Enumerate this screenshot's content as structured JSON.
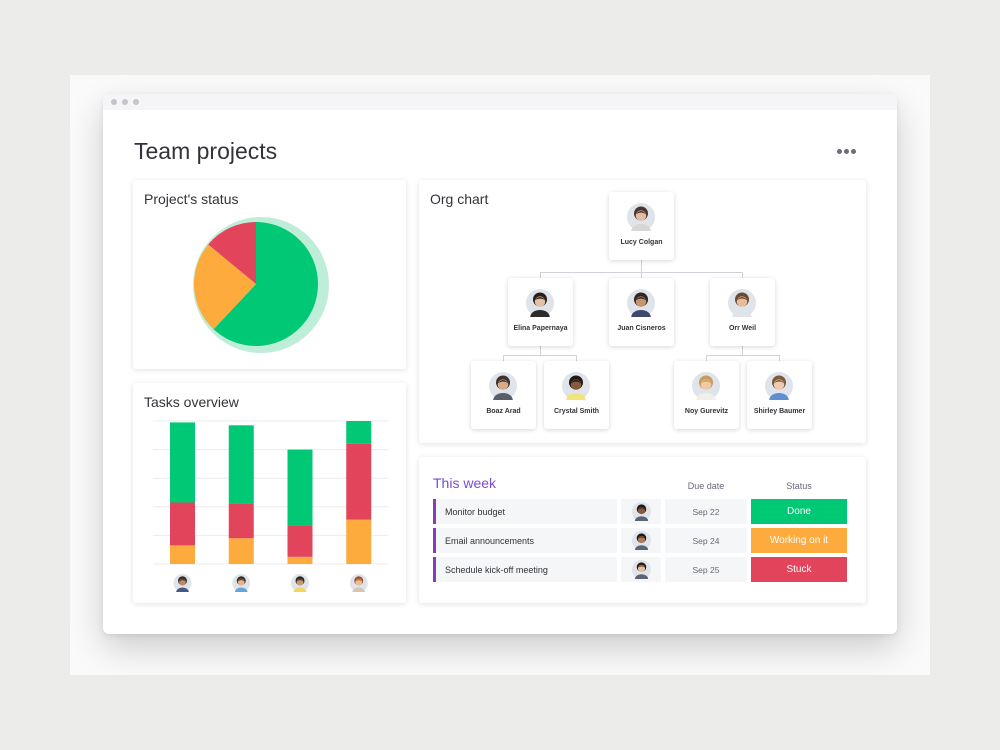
{
  "page_title": "Team projects",
  "colors": {
    "green": "#00c875",
    "green_light": "#bfeed8",
    "red": "#e2445c",
    "orange": "#fdab3d",
    "purple": "#784bd1",
    "week_bar": "#8a3bb8"
  },
  "project_status": {
    "title": "Project's status",
    "slices": [
      {
        "status": "done",
        "fraction": 0.62,
        "color": "#00c875"
      },
      {
        "status": "working",
        "fraction": 0.24,
        "color": "#fdab3d"
      },
      {
        "status": "stuck",
        "fraction": 0.14,
        "color": "#e2445c"
      }
    ]
  },
  "chart_data": [
    {
      "type": "pie",
      "title": "Project's status",
      "values": [
        62,
        24,
        14
      ],
      "colors": [
        "#00c875",
        "#fdab3d",
        "#e2445c"
      ]
    },
    {
      "type": "bar",
      "title": "Tasks overview",
      "stacked": true,
      "categories": [
        "person 1",
        "person 2",
        "person 3",
        "person 4"
      ],
      "ylim": [
        0,
        100
      ],
      "grid": true,
      "series": [
        {
          "status": "working",
          "color": "#fdab3d",
          "values": [
            13,
            18,
            5,
            31
          ]
        },
        {
          "status": "stuck",
          "color": "#e2445c",
          "values": [
            30,
            24,
            22,
            53
          ]
        },
        {
          "status": "done",
          "color": "#00c875",
          "values": [
            56,
            55,
            53,
            16
          ]
        }
      ]
    }
  ],
  "tasks_overview": {
    "title": "Tasks overview",
    "avatars": [
      {
        "icon": "avatar-icon",
        "skin": "#b98a6a",
        "hair": "#3a2a22",
        "shirt": "#445a80"
      },
      {
        "icon": "avatar-icon",
        "skin": "#e2b48f",
        "hair": "#3b2b1f",
        "shirt": "#6aa3d8"
      },
      {
        "icon": "avatar-icon",
        "skin": "#c79a73",
        "hair": "#2e2622",
        "shirt": "#f3d65a"
      },
      {
        "icon": "avatar-icon",
        "skin": "#e9bd98",
        "hair": "#a0502d",
        "shirt": "#d9c3b0"
      }
    ]
  },
  "org_chart": {
    "title": "Org chart",
    "root": {
      "name": "Lucy Colgan",
      "skin": "#e3bca0",
      "hair": "#4a3630",
      "shirt": "#d6d6d6"
    },
    "managers": [
      {
        "name": "Elina Papernaya",
        "skin": "#e6c0a3",
        "hair": "#2a1d18",
        "shirt": "#2b2b2b"
      },
      {
        "name": "Juan Cisneros",
        "skin": "#c9936d",
        "hair": "#2d2622",
        "shirt": "#3e4a6b"
      },
      {
        "name": "Orr Weil",
        "skin": "#e5bd9c",
        "hair": "#6b4a33",
        "shirt": "#dfe4ea"
      }
    ],
    "reports": [
      {
        "name": "Boaz Arad",
        "skin": "#d9a988",
        "hair": "#3a3330",
        "shirt": "#595f69"
      },
      {
        "name": "Crystal Smith",
        "skin": "#8a5a3c",
        "hair": "#1e1a18",
        "shirt": "#f2e37a"
      },
      {
        "name": "Noy Gurevitz",
        "skin": "#efcaa5",
        "hair": "#c89b5e",
        "shirt": "#f0efe9"
      },
      {
        "name": "Shirley Baumer",
        "skin": "#f0cab0",
        "hair": "#7a5a3a",
        "shirt": "#5f8fd0"
      }
    ]
  },
  "this_week": {
    "title": "This week",
    "columns": {
      "due": "Due date",
      "status": "Status"
    },
    "rows": [
      {
        "name": "Monitor budget",
        "date": "Sep 22",
        "status": "Done",
        "status_color": "#00c875",
        "skin": "#8a5a3c",
        "hair": "#1e1a18"
      },
      {
        "name": "Email announcements",
        "date": "Sep 24",
        "status": "Working on it",
        "status_color": "#fdab3d",
        "skin": "#b07b58",
        "hair": "#201a17"
      },
      {
        "name": "Schedule kick-off meeting",
        "date": "Sep 25",
        "status": "Stuck",
        "status_color": "#e2445c",
        "skin": "#e6c0a3",
        "hair": "#2a1d18"
      }
    ]
  }
}
